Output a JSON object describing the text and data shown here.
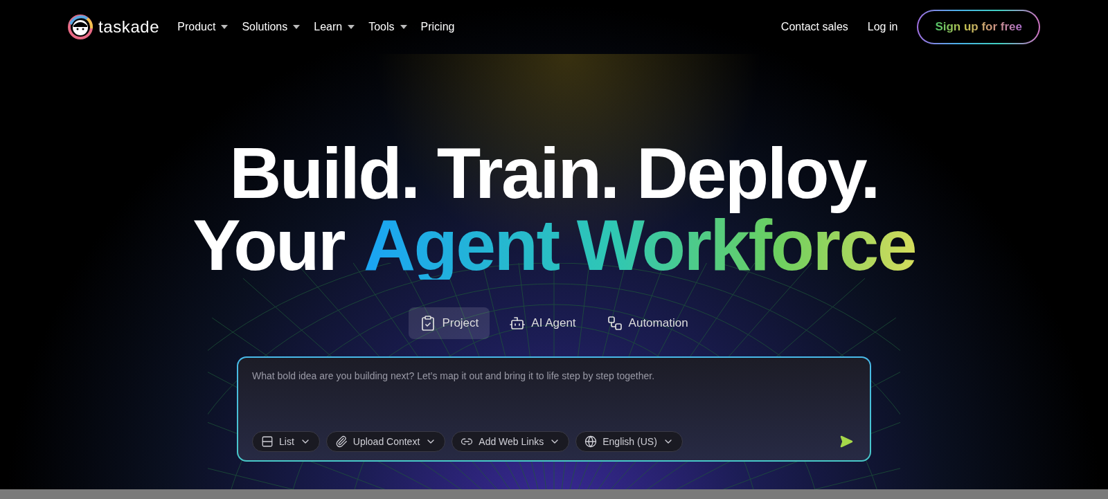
{
  "nav": {
    "brand": "taskade",
    "menu": [
      {
        "label": "Product",
        "dropdown": true
      },
      {
        "label": "Solutions",
        "dropdown": true
      },
      {
        "label": "Learn",
        "dropdown": true
      },
      {
        "label": "Tools",
        "dropdown": true
      },
      {
        "label": "Pricing",
        "dropdown": false
      }
    ],
    "contact": "Contact sales",
    "login": "Log in",
    "signup": "Sign up for free"
  },
  "hero": {
    "line1": "Build. Train. Deploy.",
    "line2_plain": "Your",
    "line2_gradient": "Agent Workforce"
  },
  "modes": [
    {
      "label": "Project",
      "selected": true
    },
    {
      "label": "AI Agent",
      "selected": false
    },
    {
      "label": "Automation",
      "selected": false
    }
  ],
  "prompt": {
    "placeholder": "What bold idea are you building next? Let’s map it out and bring it to life step by step together.",
    "options": [
      {
        "label": "List"
      },
      {
        "label": "Upload Context"
      },
      {
        "label": "Add Web Links"
      },
      {
        "label": "English (US)"
      }
    ]
  }
}
